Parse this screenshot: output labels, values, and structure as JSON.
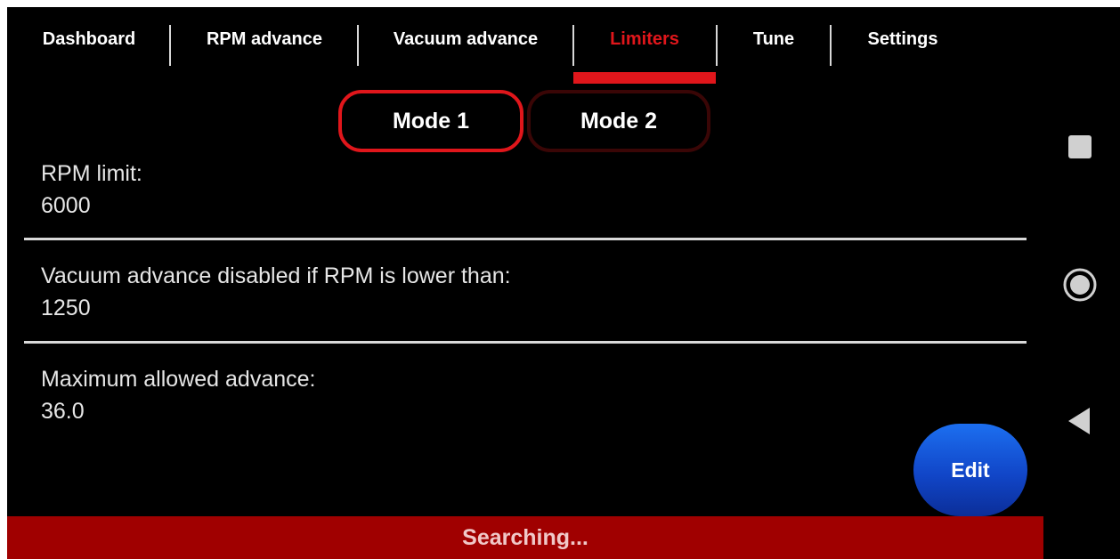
{
  "tabs": [
    {
      "label": "Dashboard",
      "active": false
    },
    {
      "label": "RPM advance",
      "active": false
    },
    {
      "label": "Vacuum advance",
      "active": false
    },
    {
      "label": "Limiters",
      "active": true
    },
    {
      "label": "Tune",
      "active": false
    },
    {
      "label": "Settings",
      "active": false
    }
  ],
  "modes": [
    {
      "label": "Mode 1",
      "selected": true
    },
    {
      "label": "Mode 2",
      "selected": false
    }
  ],
  "settings": [
    {
      "label": "RPM limit:",
      "value": "6000"
    },
    {
      "label": "Vacuum advance disabled if RPM is lower than:",
      "value": "1250"
    },
    {
      "label": "Maximum allowed advance:",
      "value": "36.0"
    }
  ],
  "edit_button": {
    "label": "Edit"
  },
  "status": {
    "text": "Searching..."
  },
  "system_nav": {
    "icons": [
      "recents-square-icon",
      "home-circle-icon",
      "back-triangle-icon"
    ]
  },
  "colors": {
    "accent": "#e0161b",
    "background": "#000000",
    "status_bar": "#a00000",
    "edit_button": "#1146c8"
  }
}
